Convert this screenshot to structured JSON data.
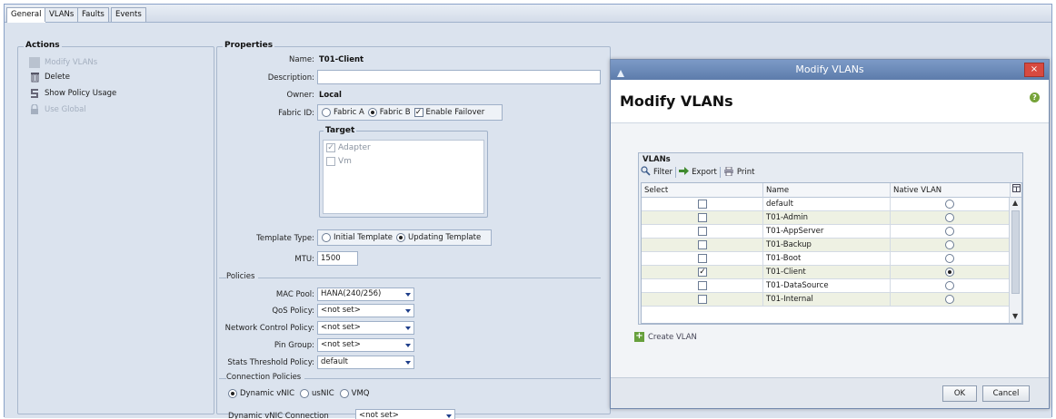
{
  "tabs": [
    "General",
    "VLANs",
    "Faults",
    "Events"
  ],
  "actions": {
    "title": "Actions",
    "items": [
      {
        "label": "Modify VLANs",
        "icon": "vlan-icon",
        "enabled": false
      },
      {
        "label": "Delete",
        "icon": "trash-icon",
        "enabled": true
      },
      {
        "label": "Show Policy Usage",
        "icon": "policy-usage-icon",
        "enabled": true
      },
      {
        "label": "Use Global",
        "icon": "lock-icon",
        "enabled": false
      }
    ]
  },
  "properties": {
    "title": "Properties",
    "name_label": "Name:",
    "name_value": "T01-Client",
    "description_label": "Description:",
    "description_value": "",
    "owner_label": "Owner:",
    "owner_value": "Local",
    "fabric_label": "Fabric ID:",
    "fabric_a": "Fabric A",
    "fabric_b": "Fabric B",
    "fabric_selected": "Fabric B",
    "failover_label": "Enable Failover",
    "failover_checked": true,
    "target_title": "Target",
    "target_items": [
      {
        "label": "Adapter",
        "checked": true
      },
      {
        "label": "Vm",
        "checked": false
      }
    ],
    "template_type_label": "Template Type:",
    "template_initial": "Initial Template",
    "template_updating": "Updating Template",
    "template_selected": "Updating Template",
    "mtu_label": "MTU:",
    "mtu_value": "1500"
  },
  "policies": {
    "section_label": "Policies",
    "mac_pool_label": "MAC Pool:",
    "mac_pool_value": "HANA(240/256)",
    "qos_label": "QoS Policy:",
    "qos_value": "<not set>",
    "ncp_label": "Network Control Policy:",
    "ncp_value": "<not set>",
    "pin_label": "Pin Group:",
    "pin_value": "<not set>",
    "stats_label": "Stats Threshold Policy:",
    "stats_value": "default"
  },
  "connection": {
    "section_label": "Connection Policies",
    "opt_dynamic": "Dynamic vNIC",
    "opt_usnic": "usNIC",
    "opt_vmq": "VMQ",
    "selected": "Dynamic vNIC",
    "dyn_policy_label": "Dynamic vNIC Connection Policy:",
    "dyn_policy_value": "<not set>"
  },
  "modal": {
    "window_title": "Modify VLANs",
    "heading": "Modify VLANs",
    "close": "×",
    "help": "?",
    "vlans_title": "VLANs",
    "tools": {
      "filter": "Filter",
      "export": "Export",
      "print": "Print"
    },
    "columns": {
      "select": "Select",
      "name": "Name",
      "native": "Native VLAN"
    },
    "rows": [
      {
        "name": "default",
        "selected": false,
        "native": false
      },
      {
        "name": "T01-Admin",
        "selected": false,
        "native": false
      },
      {
        "name": "T01-AppServer",
        "selected": false,
        "native": false
      },
      {
        "name": "T01-Backup",
        "selected": false,
        "native": false
      },
      {
        "name": "T01-Boot",
        "selected": false,
        "native": false
      },
      {
        "name": "T01-Client",
        "selected": true,
        "native": true
      },
      {
        "name": "T01-DataSource",
        "selected": false,
        "native": false
      },
      {
        "name": "T01-Internal",
        "selected": false,
        "native": false
      }
    ],
    "create_vlan": "Create VLAN",
    "ok": "OK",
    "cancel": "Cancel"
  }
}
